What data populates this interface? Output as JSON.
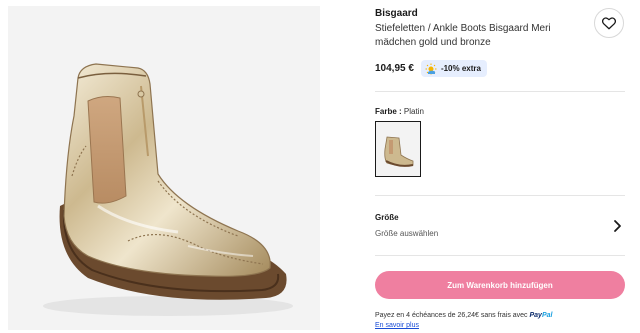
{
  "product": {
    "brand": "Bisgaard",
    "name": "Stiefeletten / Ankle Boots Bisgaard Meri mädchen gold und bronze",
    "price": "104,95 €",
    "promo_badge": "-10% extra"
  },
  "color": {
    "label": "Farbe :",
    "value": "Platin"
  },
  "size": {
    "title": "Größe",
    "placeholder": "Größe auswählen"
  },
  "cart": {
    "button_label": "Zum Warenkorb hinzufügen"
  },
  "payment": {
    "installment_text": "Payez en 4 échéances de 26,24€ sans frais avec",
    "paypal_brand_1": "Pay",
    "paypal_brand_2": "Pal",
    "learn_more": "En savoir plus"
  },
  "icons": {
    "wishlist": "heart-icon",
    "promo": "sun-icon",
    "size_chevron": "chevron-right-icon"
  },
  "colors": {
    "accent_pink": "#ef7fa0",
    "promo_bg": "#e6eefe",
    "link_blue": "#1a4dd6"
  }
}
